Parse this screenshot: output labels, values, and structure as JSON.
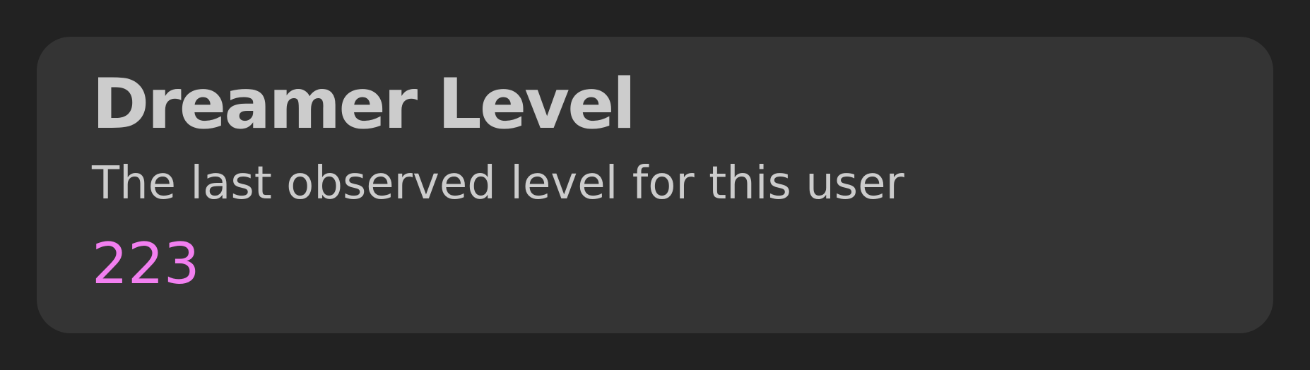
{
  "card": {
    "title": "Dreamer Level",
    "description": "The last observed level for this user",
    "value": "223",
    "value_color": "#f27ff0"
  }
}
